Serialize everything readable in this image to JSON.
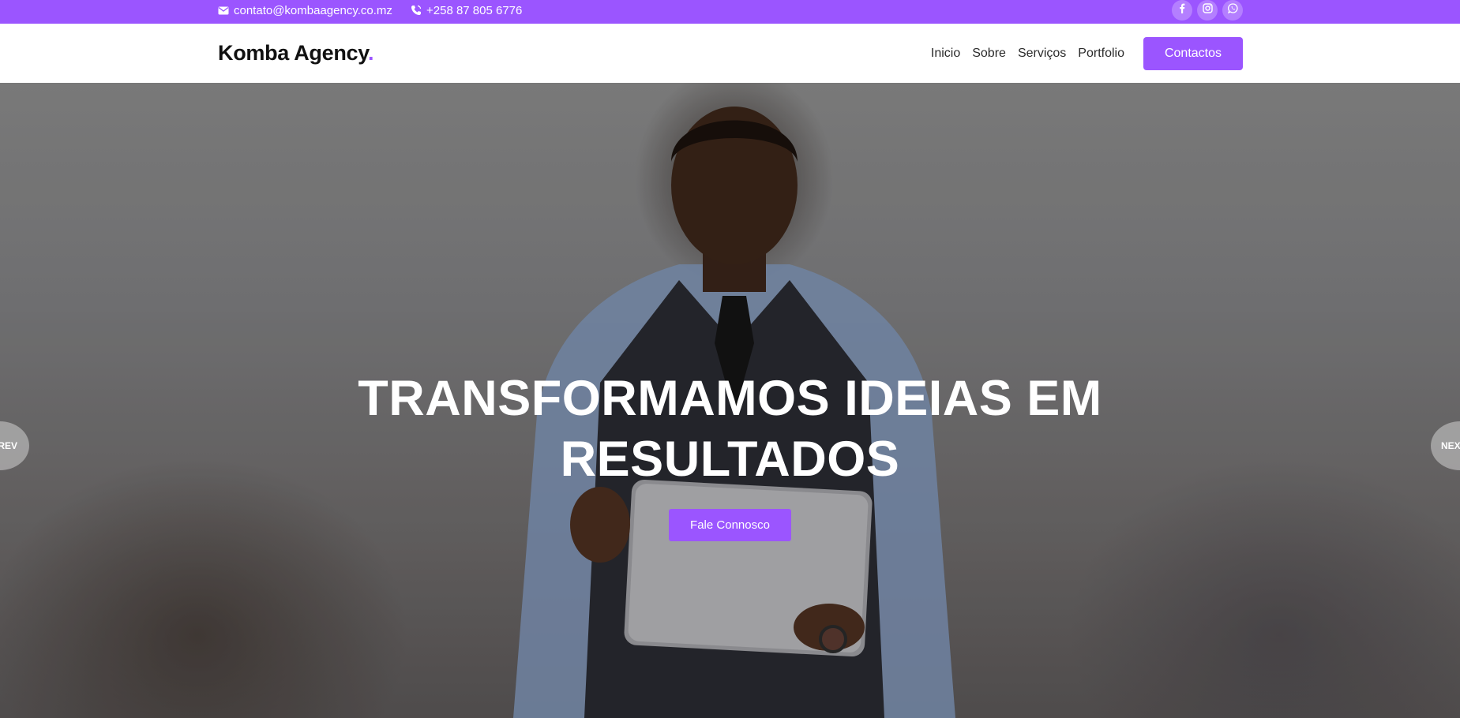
{
  "topbar": {
    "email": "contato@kombaagency.co.mz",
    "phone": "+258 87 805 6776",
    "email_icon": "envelope-icon",
    "phone_icon": "phone-icon",
    "socials": [
      "facebook-icon",
      "instagram-icon",
      "whatsapp-icon"
    ]
  },
  "header": {
    "logo_text": "Komba Agency",
    "logo_dot": ".",
    "nav": [
      "Inicio",
      "Sobre",
      "Serviços",
      "Portfolio"
    ],
    "cta": "Contactos"
  },
  "hero": {
    "title_line1": "TRANSFORMAMOS IDEIAS EM",
    "title_line2": "RESULTADOS",
    "cta": "Fale Connosco",
    "prev_label": "REV",
    "next_label": "NEX"
  },
  "colors": {
    "accent": "#9b55ff",
    "topbar_bg": "#9b55ff",
    "header_bg": "#ffffff",
    "text_dark": "#111111"
  }
}
